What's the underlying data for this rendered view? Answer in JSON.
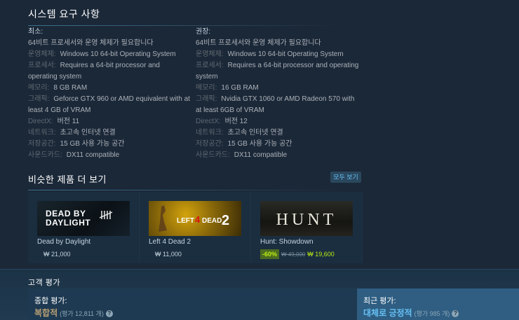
{
  "sysreq": {
    "title": "시스템 요구 사항",
    "minimum": {
      "header": "최소:",
      "note": "64비트 프로세서와 운영 체제가 필요합니다",
      "os_k": "운영체제:",
      "os_v": "Windows 10 64-bit Operating System",
      "cpu_k": "프로세서:",
      "cpu_v": "Requires a 64-bit processor and operating system",
      "mem_k": "메모리:",
      "mem_v": "8 GB RAM",
      "gpu_k": "그래픽:",
      "gpu_v": "Geforce GTX 960 or AMD equivalent with at least 4 GB of VRAM",
      "dx_k": "DirectX:",
      "dx_v": "버전 11",
      "net_k": "네트워크:",
      "net_v": "초고속 인터넷 연결",
      "disk_k": "저장공간:",
      "disk_v": "15 GB 사용 가능 공간",
      "snd_k": "사운드카드:",
      "snd_v": "DX11 compatible"
    },
    "recommended": {
      "header": "권장:",
      "note": "64비트 프로세서와 운영 체제가 필요합니다",
      "os_k": "운영체제:",
      "os_v": "Windows 10 64-bit Operating System",
      "cpu_k": "프로세서:",
      "cpu_v": "Requires a 64-bit processor and operating system",
      "mem_k": "메모리:",
      "mem_v": "16 GB RAM",
      "gpu_k": "그래픽:",
      "gpu_v": "Nvidia GTX 1060 or AMD Radeon 570 with at least 6GB of VRAM",
      "dx_k": "DirectX:",
      "dx_v": "버전 12",
      "net_k": "네트워크:",
      "net_v": "초고속 인터넷 연결",
      "disk_k": "저장공간:",
      "disk_v": "15 GB 사용 가능 공간",
      "snd_k": "사운드카드:",
      "snd_v": "DX11 compatible"
    }
  },
  "similar": {
    "title": "비슷한 제품 더 보기",
    "see_all": "모두 보기",
    "items": [
      {
        "name": "Dead by Daylight",
        "price": "₩ 21,000",
        "logo_top": "DEAD BY",
        "logo_bottom": "DAYLIGHT"
      },
      {
        "name": "Left 4 Dead 2",
        "price": "₩ 11,000",
        "logo_top": "LEFT",
        "logo_num": "4",
        "logo_bottom": "DEAD",
        "logo_num2": "2"
      },
      {
        "name": "Hunt: Showdown",
        "discount": "-60%",
        "original": "₩ 49,000",
        "final": "₩ 19,600",
        "logo_top": "HUNT"
      }
    ]
  },
  "reviews": {
    "title": "고객 평가",
    "overall": {
      "label": "종합 평가:",
      "summary": "복합적",
      "count": "(평가 12,811 개)"
    },
    "recent": {
      "label": "최근 평가:",
      "summary": "대체로 긍정적",
      "count": "(평가 985 개)"
    },
    "help_glyph": "?"
  },
  "colors": {
    "background": "#1b2838",
    "heading": "#ffffff",
    "link": "#67c1f5",
    "mixed": "#b9a074",
    "positive": "#66c0f4",
    "discount_bg": "#4c6b22",
    "discount_fg": "#beee11"
  }
}
